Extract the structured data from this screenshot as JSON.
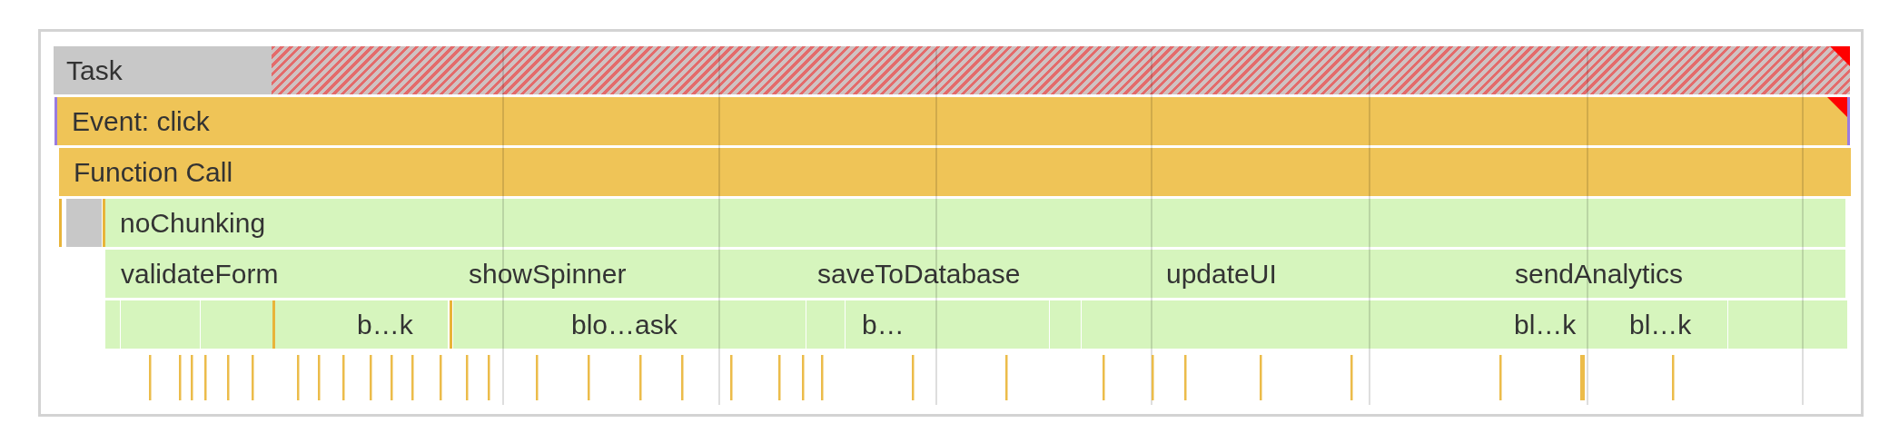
{
  "flame_chart": {
    "rows": [
      {
        "bars": [
          {
            "kind": "task",
            "label": "Task",
            "warning": true
          }
        ]
      },
      {
        "bars": [
          {
            "kind": "event",
            "label": "Event: click",
            "warning": true
          }
        ]
      },
      {
        "bars": [
          {
            "kind": "function",
            "label": "Function Call",
            "warning": false
          }
        ]
      },
      {
        "bars": [
          {
            "kind": "marker",
            "warning": false
          },
          {
            "kind": "system",
            "warning": false
          },
          {
            "kind": "marker",
            "warning": false
          },
          {
            "kind": "script",
            "label": "noChunking",
            "warning": false
          }
        ]
      },
      {
        "bars": [
          {
            "kind": "script",
            "label": "validateForm",
            "warning": false
          },
          {
            "kind": "script",
            "label": "showSpinner",
            "warning": false
          },
          {
            "kind": "script",
            "label": "saveToDatabase",
            "warning": false
          },
          {
            "kind": "script",
            "label": "updateUI",
            "warning": false
          },
          {
            "kind": "script",
            "label": "sendAnalytics",
            "warning": false
          }
        ]
      },
      {
        "bars": [
          {
            "kind": "script",
            "warning": false
          },
          {
            "kind": "script",
            "warning": false
          },
          {
            "kind": "script",
            "warning": false
          },
          {
            "kind": "marker",
            "warning": false
          },
          {
            "kind": "script",
            "label": "b…k",
            "warning": false
          },
          {
            "kind": "marker",
            "warning": false
          },
          {
            "kind": "script",
            "label": "blo…ask",
            "warning": false
          },
          {
            "kind": "script",
            "warning": false
          },
          {
            "kind": "script",
            "label": "b…",
            "warning": false
          },
          {
            "kind": "script",
            "warning": false
          },
          {
            "kind": "script",
            "warning": false
          },
          {
            "kind": "script",
            "label": "bl…k",
            "warning": false
          },
          {
            "kind": "script",
            "label": "bl…k",
            "warning": false
          },
          {
            "kind": "script",
            "warning": false
          }
        ]
      }
    ]
  }
}
